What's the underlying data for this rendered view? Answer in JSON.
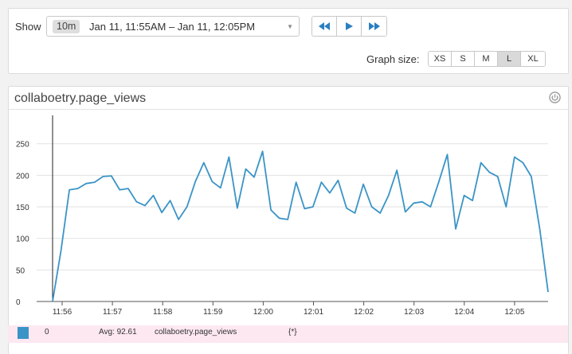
{
  "controls": {
    "show_label": "Show",
    "range_chip": "10m",
    "range_text": "Jan 11, 11:55AM – Jan 11, 12:05PM",
    "nav_buttons": [
      {
        "name": "rewind",
        "icon": "rewind-icon"
      },
      {
        "name": "play",
        "icon": "play-icon"
      },
      {
        "name": "fast-forward",
        "icon": "fast-forward-icon"
      }
    ],
    "graph_size_label": "Graph size:",
    "sizes": [
      "XS",
      "S",
      "M",
      "L",
      "XL"
    ],
    "active_size": "L",
    "accent_color": "#2a7fc1"
  },
  "graph": {
    "title": "collaboetry.page_views",
    "power_icon": "power-icon",
    "line_color": "#3a94c6"
  },
  "legend": {
    "index": "0",
    "avg": "Avg: 92.61",
    "metric": "collaboetry.page_views",
    "tags": "{*}",
    "swatch_color": "#3a94c6",
    "row_color": "#fde8f2"
  },
  "chart_data": {
    "type": "line",
    "ylim": [
      0,
      250
    ],
    "y_ticks": [
      "0",
      "50",
      "100",
      "150",
      "200",
      "250"
    ],
    "x_ticks": [
      "11:56",
      "11:57",
      "11:58",
      "11:59",
      "12:00",
      "12:01",
      "12:02",
      "12:03",
      "12:04",
      "12:05"
    ],
    "grid": true,
    "series": [
      {
        "values": [
          0,
          80,
          177,
          179,
          187,
          189,
          198,
          199,
          177,
          179,
          158,
          152,
          168,
          141,
          160,
          130,
          150,
          190,
          220,
          190,
          180,
          229,
          148,
          210,
          197,
          238,
          145,
          132,
          130,
          189,
          147,
          150,
          189,
          172,
          192,
          148,
          140,
          186,
          150,
          140,
          168,
          208,
          142,
          156,
          158,
          150,
          190,
          233,
          115,
          168,
          160,
          220,
          205,
          198,
          150,
          229,
          220,
          198,
          115,
          15
        ]
      }
    ]
  }
}
